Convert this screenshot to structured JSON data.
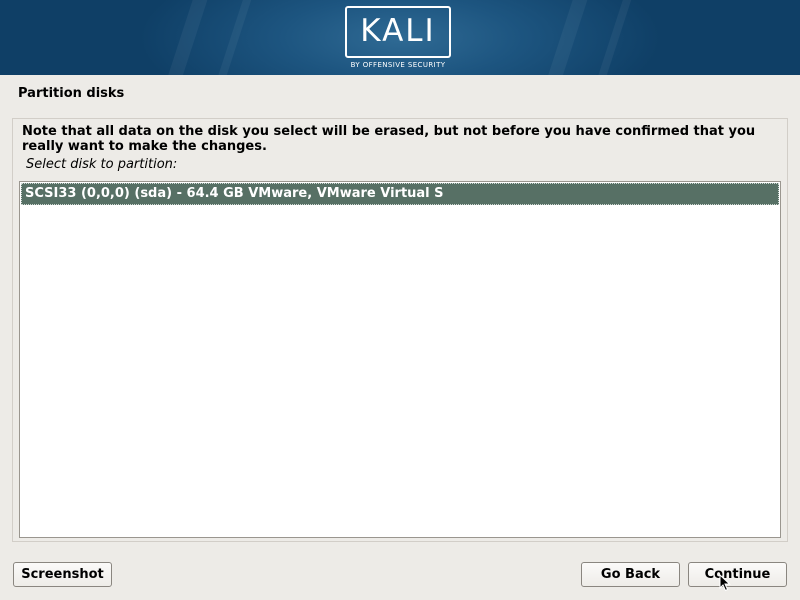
{
  "header": {
    "logo_text": "KALI",
    "logo_tagline": "BY OFFENSIVE SECURITY"
  },
  "page": {
    "title": "Partition disks",
    "note": "Note that all data on the disk you select will be erased, but not before you have confirmed that you really want to make the changes.",
    "select_label": "Select disk to partition:"
  },
  "disks": [
    {
      "label": "SCSI33 (0,0,0) (sda) - 64.4 GB VMware, VMware Virtual S",
      "selected": true
    }
  ],
  "buttons": {
    "screenshot": "Screenshot",
    "go_back": "Go Back",
    "continue": "Continue"
  },
  "colors": {
    "banner": "#1d5580",
    "selection": "#577065",
    "background": "#edebe7"
  }
}
